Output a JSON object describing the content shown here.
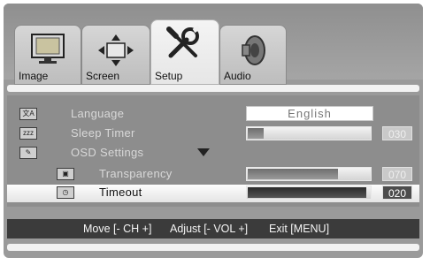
{
  "tabs": [
    {
      "label": "Image",
      "icon": "monitor-icon"
    },
    {
      "label": "Screen",
      "icon": "screen-arrows-icon"
    },
    {
      "label": "Setup",
      "icon": "tools-icon",
      "active": true
    },
    {
      "label": "Audio",
      "icon": "speaker-icon"
    }
  ],
  "menu": {
    "language": {
      "label": "Language",
      "value": "English"
    },
    "sleep_timer": {
      "label": "Sleep Timer",
      "value": "030",
      "level": 0.13
    },
    "osd_settings": {
      "label": "OSD Settings"
    },
    "transparency": {
      "label": "Transparency",
      "value": "070",
      "level": 0.74
    },
    "timeout": {
      "label": "Timeout",
      "value": "020",
      "level": 0.97
    }
  },
  "footer": {
    "move": "Move [- CH +]",
    "adjust": "Adjust [- VOL +]",
    "exit": "Exit [MENU]"
  }
}
